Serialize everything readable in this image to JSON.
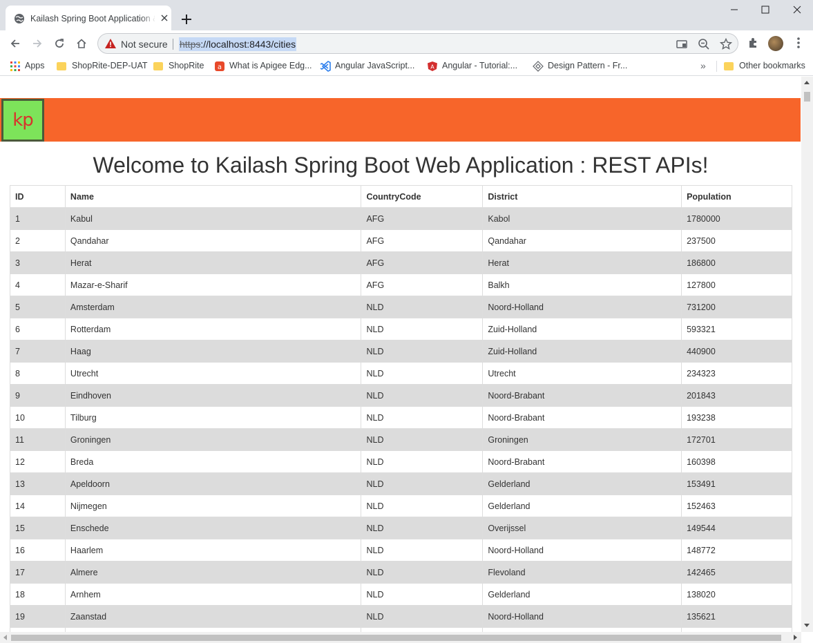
{
  "browser": {
    "tab_title": "Kailash Spring Boot Application & ",
    "security_label": "Not secure",
    "url_scheme": "https",
    "url_rest": "://localhost:8443/cities",
    "bookmarks": [
      {
        "label": "Apps",
        "icon": "apps-grid-icon"
      },
      {
        "label": "ShopRite-DEP-UAT",
        "icon": "folder-icon"
      },
      {
        "label": "ShopRite",
        "icon": "folder-icon"
      },
      {
        "label": "What is Apigee Edg...",
        "icon": "apigee-icon"
      },
      {
        "label": "Angular JavaScript...",
        "icon": "vscode-icon"
      },
      {
        "label": "Angular - Tutorial:...",
        "icon": "angular-icon"
      },
      {
        "label": "Design Pattern - Fr...",
        "icon": "design-pattern-icon"
      }
    ],
    "bookmarks_overflow": "»",
    "other_bookmarks": "Other bookmarks"
  },
  "page": {
    "logo_text": "kp",
    "heading": "Welcome to Kailash Spring Boot Web Application : REST APIs!",
    "colors": {
      "banner": "#f7652a",
      "logo_bg": "#7de35a",
      "logo_text": "#d8332c",
      "row_alt": "#dcdcdc"
    }
  },
  "table": {
    "columns": [
      "ID",
      "Name",
      "CountryCode",
      "District",
      "Population"
    ],
    "rows": [
      [
        "1",
        "Kabul",
        "AFG",
        "Kabol",
        "1780000"
      ],
      [
        "2",
        "Qandahar",
        "AFG",
        "Qandahar",
        "237500"
      ],
      [
        "3",
        "Herat",
        "AFG",
        "Herat",
        "186800"
      ],
      [
        "4",
        "Mazar-e-Sharif",
        "AFG",
        "Balkh",
        "127800"
      ],
      [
        "5",
        "Amsterdam",
        "NLD",
        "Noord-Holland",
        "731200"
      ],
      [
        "6",
        "Rotterdam",
        "NLD",
        "Zuid-Holland",
        "593321"
      ],
      [
        "7",
        "Haag",
        "NLD",
        "Zuid-Holland",
        "440900"
      ],
      [
        "8",
        "Utrecht",
        "NLD",
        "Utrecht",
        "234323"
      ],
      [
        "9",
        "Eindhoven",
        "NLD",
        "Noord-Brabant",
        "201843"
      ],
      [
        "10",
        "Tilburg",
        "NLD",
        "Noord-Brabant",
        "193238"
      ],
      [
        "11",
        "Groningen",
        "NLD",
        "Groningen",
        "172701"
      ],
      [
        "12",
        "Breda",
        "NLD",
        "Noord-Brabant",
        "160398"
      ],
      [
        "13",
        "Apeldoorn",
        "NLD",
        "Gelderland",
        "153491"
      ],
      [
        "14",
        "Nijmegen",
        "NLD",
        "Gelderland",
        "152463"
      ],
      [
        "15",
        "Enschede",
        "NLD",
        "Overijssel",
        "149544"
      ],
      [
        "16",
        "Haarlem",
        "NLD",
        "Noord-Holland",
        "148772"
      ],
      [
        "17",
        "Almere",
        "NLD",
        "Flevoland",
        "142465"
      ],
      [
        "18",
        "Arnhem",
        "NLD",
        "Gelderland",
        "138020"
      ],
      [
        "19",
        "Zaanstad",
        "NLD",
        "Noord-Holland",
        "135621"
      ],
      [
        "",
        "",
        "",
        "",
        ""
      ]
    ]
  }
}
